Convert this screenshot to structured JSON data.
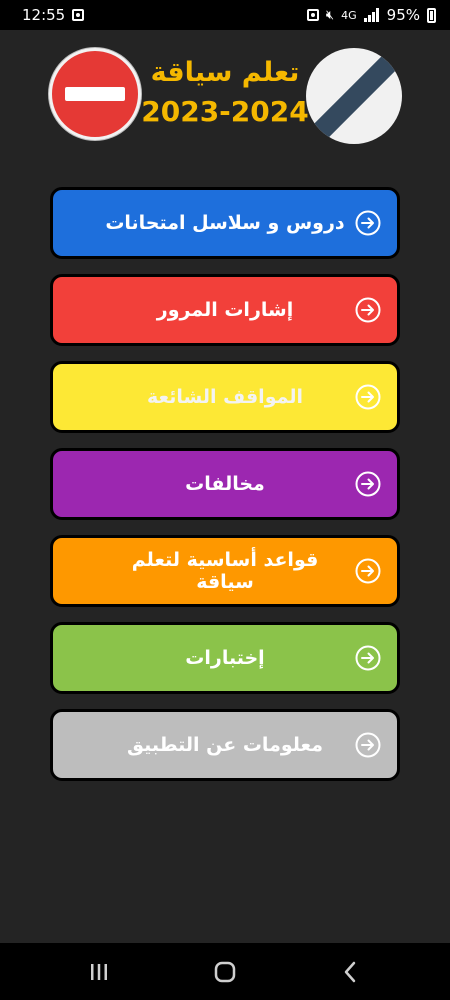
{
  "status_bar": {
    "time": "12:55",
    "network": "4G",
    "battery": "95%"
  },
  "header": {
    "title": "تعلم سياقة",
    "year": "2023-2024",
    "left_sign_icon": "no-entry-sign-icon",
    "right_sign_icon": "end-of-restriction-sign-icon"
  },
  "menu": [
    {
      "label": "دروس و سلاسل امتحانات",
      "bg": "#1e6fdc",
      "fg": "#ffffff"
    },
    {
      "label": "إشارات المرور",
      "bg": "#f2403a",
      "fg": "#ffffff"
    },
    {
      "label": "المواقف الشائعة",
      "bg": "#fde835",
      "fg": "#f3f3f3"
    },
    {
      "label": "مخالفات",
      "bg": "#9c27b0",
      "fg": "#ffffff"
    },
    {
      "label": "قواعد أساسية لتعلم سياقة",
      "bg": "#fe9800",
      "fg": "#ffffff"
    },
    {
      "label": "إختبارات",
      "bg": "#8bc34a",
      "fg": "#ffffff"
    },
    {
      "label": "معلومات عن التطبيق",
      "bg": "#bdbdbd",
      "fg": "#ffffff"
    }
  ],
  "colors": {
    "background": "#242424",
    "title": "#f5b800"
  },
  "nav": {
    "recents_icon": "recents-icon",
    "home_icon": "home-icon",
    "back_icon": "back-icon"
  }
}
